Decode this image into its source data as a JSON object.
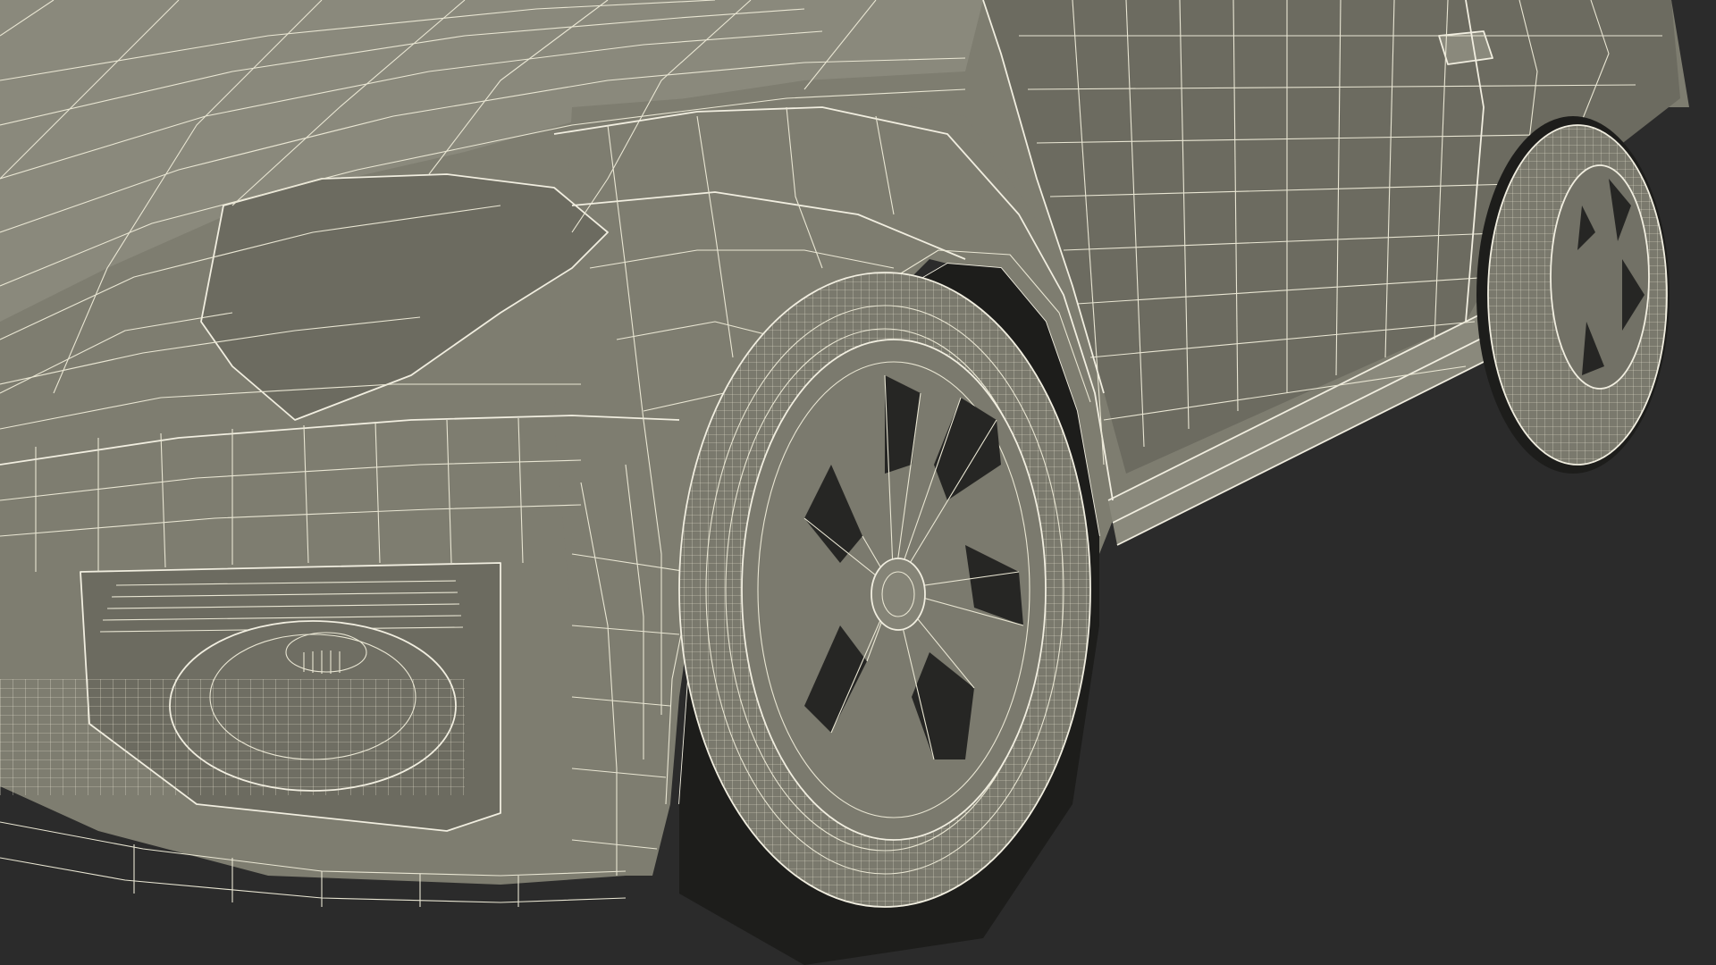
{
  "scene": {
    "background_color": "#2b2b2b",
    "model_fill_color": "#7e7d70",
    "wire_color": "#e9e6d3",
    "shadow_color": "#1d1d1b"
  }
}
